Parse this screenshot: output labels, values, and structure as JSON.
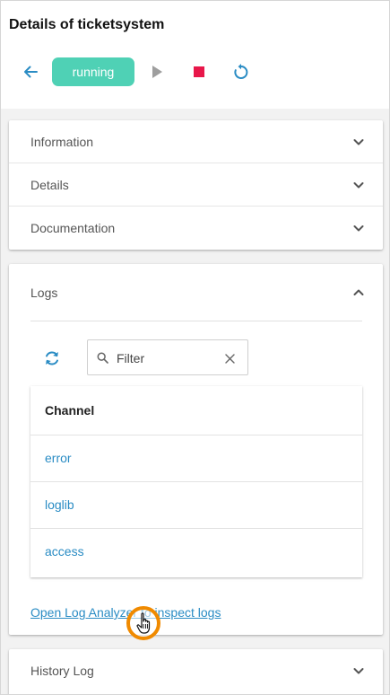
{
  "header": {
    "title": "Details of ticketsystem",
    "status": "running",
    "actions": {
      "back_icon": "arrow-left-icon",
      "play_icon": "play-icon",
      "stop_icon": "stop-icon",
      "restart_icon": "restart-icon"
    }
  },
  "accordion": {
    "items": [
      {
        "label": "Information",
        "expanded": false
      },
      {
        "label": "Details",
        "expanded": false
      },
      {
        "label": "Documentation",
        "expanded": false
      }
    ]
  },
  "logs": {
    "title": "Logs",
    "expanded": true,
    "filter": {
      "placeholder": "Filter",
      "value": ""
    },
    "table": {
      "header": "Channel",
      "rows": [
        "error",
        "loglib",
        "access"
      ]
    },
    "link_text": "Open Log Analyzer to inspect logs"
  },
  "history": {
    "label": "History Log",
    "expanded": false
  },
  "colors": {
    "accent": "#2a8cc4",
    "status_running": "#4fd1b5",
    "stop": "#e8174a",
    "cursor_highlight": "#f08a00"
  }
}
